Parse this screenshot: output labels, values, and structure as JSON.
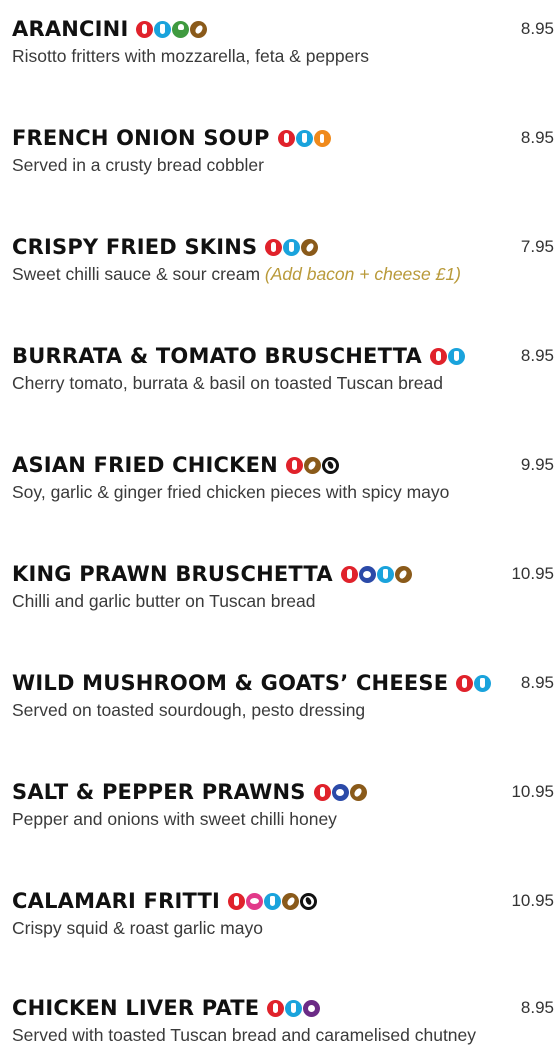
{
  "menu": {
    "items": [
      {
        "name": "ARANCINI",
        "price": "8.95",
        "description": "Risotto fritters with mozzarella, feta & peppers",
        "note": "",
        "allergens": [
          "gluten-icon",
          "milk-icon",
          "celery-icon",
          "egg-icon"
        ]
      },
      {
        "name": "FRENCH ONION SOUP",
        "price": "8.95",
        "description": "Served in a crusty bread cobbler",
        "note": "",
        "allergens": [
          "gluten-icon",
          "milk-icon",
          "mustard-icon"
        ]
      },
      {
        "name": "CRISPY FRIED SKINS",
        "price": "7.95",
        "description": "Sweet chilli sauce & sour cream ",
        "note": "(Add bacon + cheese £1)",
        "allergens": [
          "gluten-icon",
          "milk-icon",
          "egg-icon"
        ]
      },
      {
        "name": "BURRATA & TOMATO BRUSCHETTA",
        "price": "8.95",
        "description": "Cherry tomato, burrata & basil on toasted Tuscan bread",
        "note": "",
        "allergens": [
          "gluten-icon",
          "milk-icon"
        ]
      },
      {
        "name": "ASIAN FRIED CHICKEN",
        "price": "9.95",
        "description": "Soy, garlic & ginger fried chicken pieces with spicy mayo",
        "note": "",
        "allergens": [
          "gluten-icon",
          "egg-icon",
          "soya-icon"
        ]
      },
      {
        "name": "KING PRAWN BRUSCHETTA",
        "price": "10.95",
        "description": "Chilli and garlic butter on Tuscan bread",
        "note": "",
        "allergens": [
          "gluten-icon",
          "crustaceans-icon",
          "milk-icon",
          "egg-icon"
        ]
      },
      {
        "name": "WILD MUSHROOM & GOATS’ CHEESE",
        "price": "8.95",
        "description": "Served on toasted sourdough, pesto dressing",
        "note": "",
        "allergens": [
          "gluten-icon",
          "milk-icon"
        ]
      },
      {
        "name": "SALT & PEPPER PRAWNS",
        "price": "10.95",
        "description": "Pepper and onions with sweet chilli honey",
        "note": "",
        "allergens": [
          "gluten-icon",
          "crustaceans-icon",
          "egg-icon"
        ]
      },
      {
        "name": "CALAMARI FRITTI",
        "price": "10.95",
        "description": "Crispy squid & roast garlic mayo",
        "note": "",
        "allergens": [
          "gluten-icon",
          "molluscs-icon",
          "milk-icon",
          "egg-icon",
          "soya-icon"
        ]
      },
      {
        "name": "CHICKEN LIVER PATE",
        "price": "8.95",
        "description": "Served with toasted Tuscan bread and caramelised chutney",
        "note": "",
        "allergens": [
          "gluten-icon",
          "milk-icon",
          "sulphites-icon"
        ]
      }
    ]
  },
  "colors": {
    "gluten": "#e0222b",
    "milk": "#1aa3dc",
    "celery": "#3f9a3f",
    "egg": "#8a5a1a",
    "mustard": "#f08a1c",
    "soya": "#111111",
    "crustaceans": "#2b4aa8",
    "molluscs": "#e23a8a",
    "sulphites": "#6b2b86",
    "note": "#b99a3a"
  }
}
